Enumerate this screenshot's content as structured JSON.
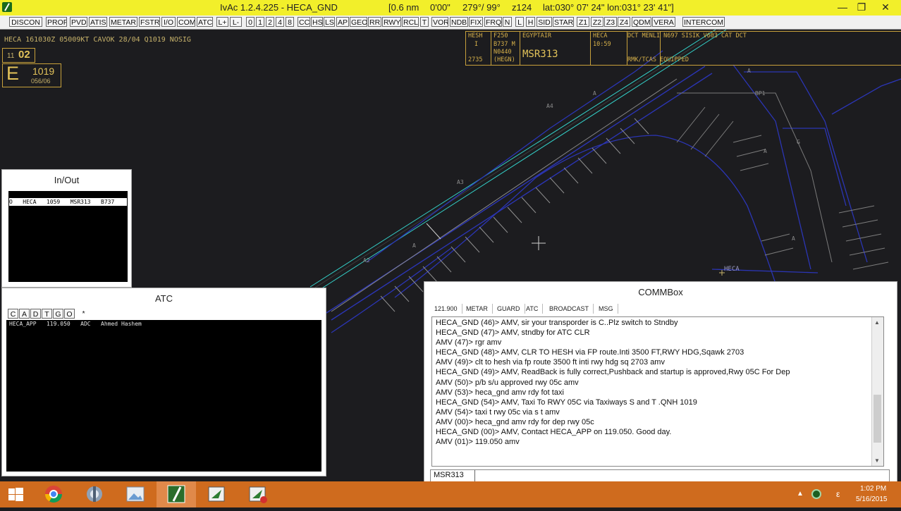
{
  "titlebar": {
    "title": "IvAc 1.2.4.225  -  HECA_GND",
    "range": "[0.6 nm",
    "time": "0'00\"",
    "heading": "279°/ 99°",
    "zoom": "z124",
    "coords": "lat:030° 07' 24\" lon:031° 23' 41\"]",
    "minimize": "—",
    "maximize": "❐",
    "close": "✕"
  },
  "toolbar": [
    "DISCON",
    "PROF",
    "PVD",
    "ATIS",
    "METAR",
    "FSTR",
    "I/O",
    "COM",
    "ATC",
    "L+",
    "L-",
    "0",
    "1",
    "2",
    "4",
    "8",
    "CC",
    "HS",
    "LS",
    "AP",
    "GEO",
    "RR",
    "RWY",
    "RCL",
    "T",
    "VOR",
    "NDB",
    "FIX",
    "FRQ",
    "N",
    "L",
    "H",
    "SID",
    "STAR",
    "Z1",
    "Z2",
    "Z3",
    "Z4",
    "QDM",
    "VERA",
    "INTERCOM"
  ],
  "radar": {
    "metar": "HECA 161030Z 05009KT CAVOK 28/04 Q1019 NOSIG",
    "rwy_small": "11",
    "rwy_big": "02",
    "atis_letter": "E",
    "qnh": "1019",
    "wind": "056/06",
    "heca_label": "HECA",
    "taxi_labels": [
      "A4",
      "A3",
      "A2",
      "A",
      "A",
      "BP1",
      "A",
      "A",
      "G",
      "A"
    ]
  },
  "strip": {
    "dest_code": "HESH",
    "rules": "I",
    "squawk": "2735",
    "fl": "F250",
    "type": "B737 M",
    "route_alt": "N0440",
    "dest_paren": "(HEGN)",
    "airline": "EGYPTAIR",
    "callsign": "MSR313",
    "dep": "HECA",
    "dep_time": "10:59",
    "route": "DCT MENLI N697 SISIK V603 CAT DCT",
    "remarks": "RMK/TCAS EQUIPPED"
  },
  "inout": {
    "title": "In/Out",
    "rows": [
      "O   HECA   1059   MSR313   B737"
    ]
  },
  "atc": {
    "title": "ATC",
    "filters": [
      "C",
      "A",
      "D",
      "T",
      "G",
      "O",
      "*"
    ],
    "rows": [
      "HECA_APP   119.050   ADC   Ahmed Hashem"
    ]
  },
  "commbox": {
    "title": "COMMBox",
    "tabs": [
      "121.900",
      "METAR",
      "GUARD",
      "ATC",
      "BROADCAST",
      "MSG"
    ],
    "lines": [
      "HECA_GND (46)> AMV, sir your transporder is C..Plz switch to Stndby",
      "HECA_GND (47)> AMV, stndby for ATC CLR",
      "AMV (47)> rgr amv",
      "HECA_GND (48)> AMV, CLR TO HESH via FP route.Inti 3500 FT,RWY HDG,Sqawk 2703",
      "AMV (49)> clt to hesh via fp route 3500 ft inti rwy hdg sq 2703 amv",
      "HECA_GND (49)> AMV, ReadBack is fully correct,Pushback and startup is approved,Rwy 05C For Dep",
      "AMV (50)> p/b s/u approved rwy 05c amv",
      "AMV (53)> heca_gnd amv rdy fot taxi",
      "HECA_GND (54)> AMV, Taxi To RWY 05C via Taxiways S and T .QNH 1019",
      "AMV (54)> taxi t rwy 05c via s t amv",
      "AMV (00)> heca_gnd amv rdy for dep rwy 05c",
      "HECA_GND (00)> AMV, Contact HECA_APP on 119.050. Good day.",
      "AMV (01)> 119.050 amv"
    ],
    "input_prefix": "MSR313",
    "input_value": ""
  },
  "taskbar": {
    "apps": [
      "windows-start-icon",
      "chrome-icon",
      "app-audio-icon",
      "image-viewer-icon",
      "ivac-icon",
      "app-green-icon",
      "app-red-icon"
    ],
    "lang": "ε",
    "time": "1:02 PM",
    "date": "5/16/2015"
  }
}
